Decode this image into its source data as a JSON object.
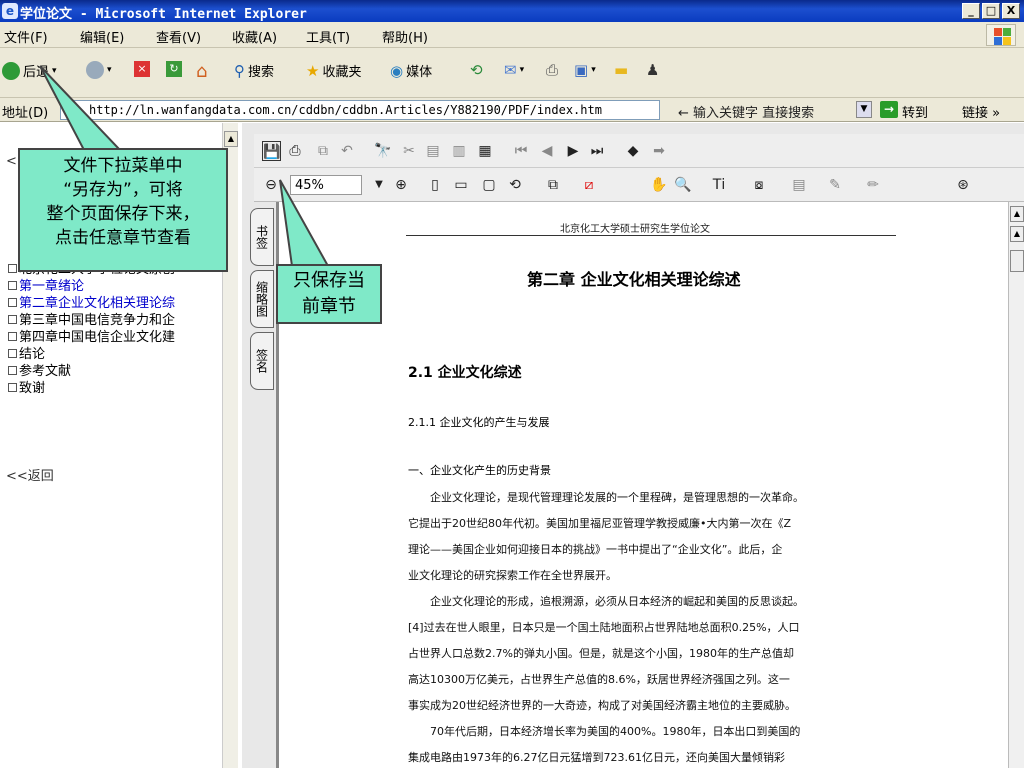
{
  "window": {
    "title": "学位论文 - Microsoft Internet Explorer",
    "controls": [
      "_",
      "□",
      "X"
    ]
  },
  "menu": [
    "文件(F)",
    "编辑(E)",
    "查看(V)",
    "收藏(A)",
    "工具(T)",
    "帮助(H)"
  ],
  "toolbar": {
    "back": "后退",
    "search": "搜索",
    "favorites": "收藏夹",
    "media": "媒体"
  },
  "address": {
    "label": "地址(D)",
    "url": "http://ln.wanfangdata.com.cn/cddbn/cddbn.Articles/Y882190/PDF/index.htm",
    "search_hint": "输入关键字 直接搜索",
    "go": "转到",
    "links": "链接 »"
  },
  "nav": {
    "back_top": "<<返回",
    "items": [
      {
        "label": "北京化工大学学位论文原创",
        "active": false
      },
      {
        "label": "第一章绪论",
        "active": true
      },
      {
        "label": "第二章企业文化相关理论综",
        "active": true
      },
      {
        "label": "第三章中国电信竞争力和企",
        "active": false
      },
      {
        "label": "第四章中国电信企业文化建",
        "active": false
      },
      {
        "label": "结论",
        "active": false
      },
      {
        "label": "参考文献",
        "active": false
      },
      {
        "label": "致谢",
        "active": false
      }
    ],
    "back_bottom": "<<返回"
  },
  "viewer": {
    "zoom": "45%",
    "tabs": [
      "书签",
      "缩略图",
      "签名"
    ]
  },
  "document": {
    "header": "北京化工大学硕士研究生学位论文",
    "chapter": "第二章 企业文化相关理论综述",
    "section": "2.1 企业文化综述",
    "subsection": "2.1.1 企业文化的产生与发展",
    "subheading": "一、企业文化产生的历史背景",
    "paragraphs": [
      "企业文化理论，是现代管理理论发展的一个里程碑，是管理思想的一次革命。",
      "它提出于20世纪80年代初。美国加里福尼亚管理学教授威廉•大内第一次在《Z",
      "理论——美国企业如何迎接日本的挑战》一书中提出了“企业文化”。此后，企",
      "业文化理论的研究探索工作在全世界展开。",
      "企业文化理论的形成，追根溯源，必须从日本经济的崛起和美国的反思谈起。",
      "[4]过去在世人眼里，日本只是一个国土陆地面积占世界陆地总面积0.25%，人口",
      "占世界人口总数2.7%的弹丸小国。但是，就是这个小国，1980年的生产总值却",
      "高达10300万亿美元，占世界生产总值的8.6%，跃居世界经济强国之列。这一",
      "事实成为20世纪经济世界的一大奇迹，构成了对美国经济霸主地位的主要威胁。",
      "70年代后期，日本经济增长率为美国的400%。1980年，日本出口到美国的",
      "集成电路由1973年的6.27亿日元猛增到723.61亿日元，还向美国大量倾销彩"
    ]
  },
  "callouts": {
    "file_menu": [
      "文件下拉菜单中",
      "“另存为”，可将",
      "整个页面保存下来，",
      "点击任意章节查看"
    ],
    "save_current": [
      "只保存当",
      "前章节"
    ]
  },
  "colors": {
    "callout_fill": "#7fe9c8",
    "titlebar": "#0a3bbf",
    "active_link": "#0000cc"
  }
}
